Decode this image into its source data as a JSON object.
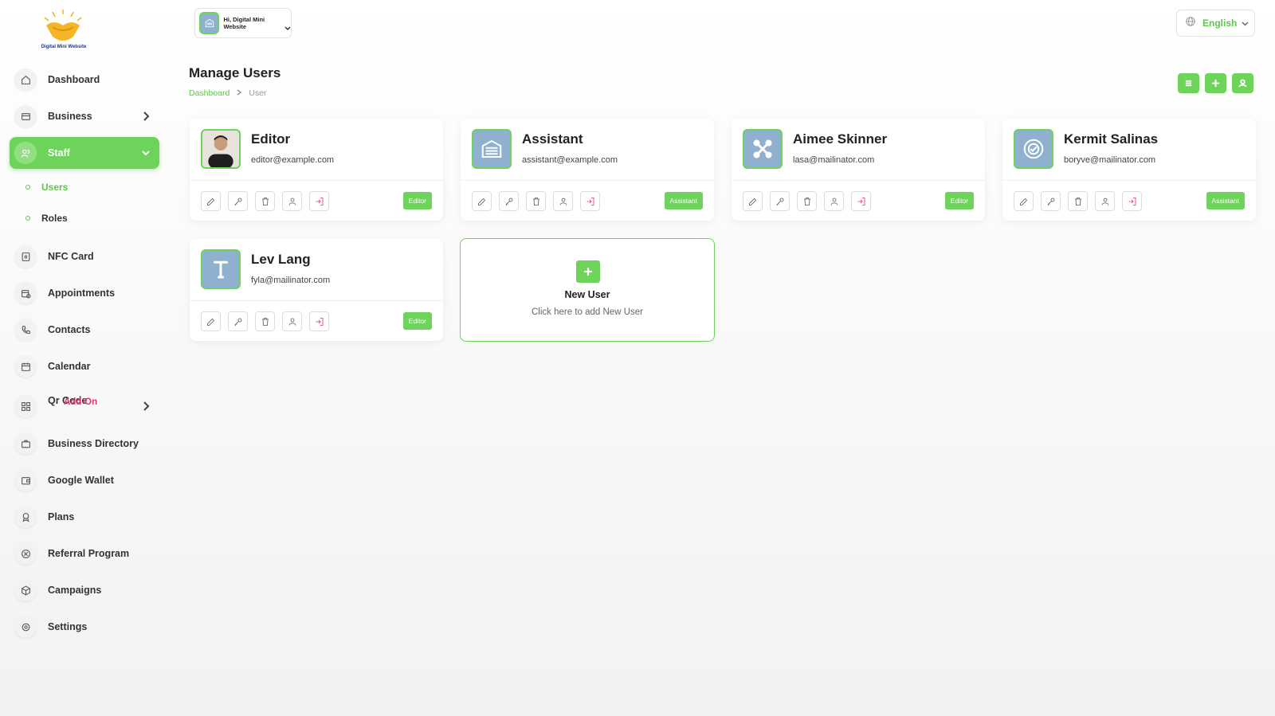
{
  "app": {
    "brand": "Digital Mini Website"
  },
  "account": {
    "label": "Hi, Digital Mini Website"
  },
  "language": {
    "label": "English"
  },
  "sidebar": {
    "items": [
      {
        "label": "Dashboard",
        "icon": "home-icon"
      },
      {
        "label": "Business",
        "icon": "business-icon"
      },
      {
        "label": "Staff",
        "icon": "users-icon"
      },
      {
        "label": "NFC Card",
        "icon": "nfc-card-icon"
      },
      {
        "label": "Appointments",
        "icon": "calendar-check-icon"
      },
      {
        "label": "Contacts",
        "icon": "phone-icon"
      },
      {
        "label": "Calendar",
        "icon": "calendar-icon"
      },
      {
        "label": "Qr Code",
        "icon": "qr-code-icon"
      },
      {
        "label": "Business Directory",
        "icon": "briefcase-icon"
      },
      {
        "label": "Google Wallet",
        "icon": "wallet-icon"
      },
      {
        "label": "Plans",
        "icon": "award-icon"
      },
      {
        "label": "Referral Program",
        "icon": "referral-icon"
      },
      {
        "label": "Campaigns",
        "icon": "box-icon"
      },
      {
        "label": "Settings",
        "icon": "gear-icon"
      }
    ],
    "staff_sub": [
      {
        "label": "Users"
      },
      {
        "label": "Roles"
      }
    ],
    "qr_addon": "Add-On"
  },
  "header": {
    "title": "Manage Users",
    "breadcrumb": [
      "Dashboard",
      "User"
    ]
  },
  "users": [
    {
      "name": "Editor",
      "email": "editor@example.com",
      "role": "Editor",
      "avatar": "person-photo"
    },
    {
      "name": "Assistant",
      "email": "assistant@example.com",
      "role": "Assistant",
      "avatar": "building-icon"
    },
    {
      "name": "Aimee Skinner",
      "email": "lasa@mailinator.com",
      "role": "Editor",
      "avatar": "joomla-icon"
    },
    {
      "name": "Kermit Salinas",
      "email": "boryve@mailinator.com",
      "role": "Assistant",
      "avatar": "badge-icon"
    },
    {
      "name": "Lev Lang",
      "email": "fyla@mailinator.com",
      "role": "Editor",
      "avatar": "letter-t-icon"
    }
  ],
  "new_user": {
    "title": "New User",
    "subtitle": "Click here to add New User"
  },
  "colors": {
    "accent": "#6ed35a",
    "addon": "#e0306e",
    "avatar_bg": "#8fb1cf"
  }
}
